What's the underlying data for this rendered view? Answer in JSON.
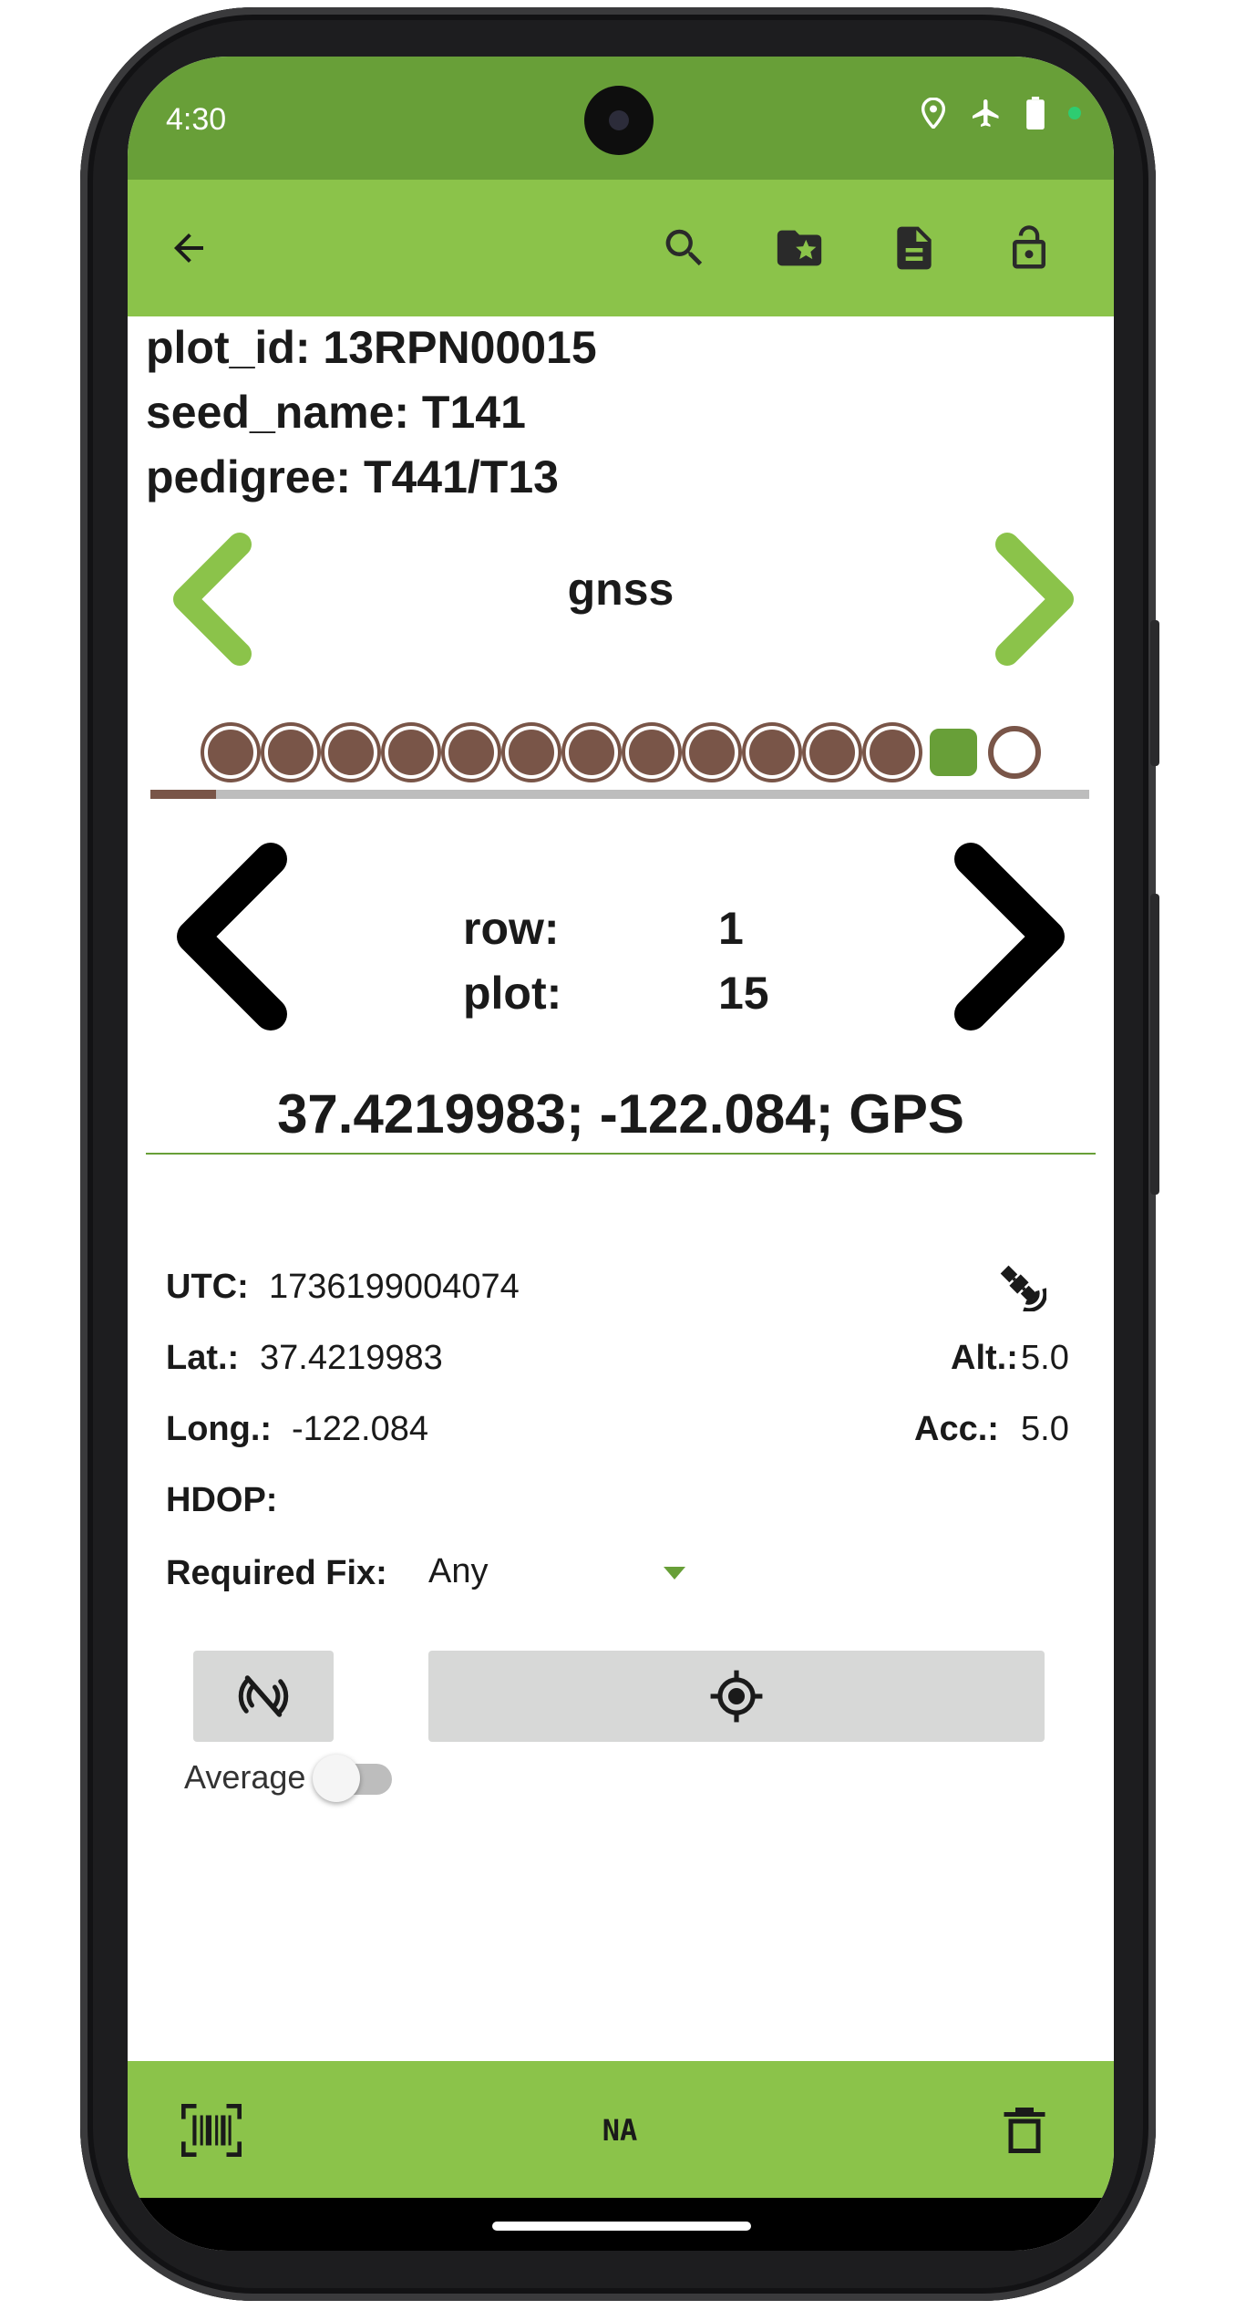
{
  "status_bar": {
    "time": "4:30",
    "icons": [
      "location-icon",
      "airplane-mode-icon",
      "battery-icon",
      "dot-indicator-icon"
    ],
    "indicator_color": "#2ecc71"
  },
  "toolbar": {
    "icons": [
      "back-arrow-icon",
      "search-icon",
      "folder-star-icon",
      "summary-document-icon",
      "lock-open-icon"
    ],
    "background": "#8bc34a"
  },
  "plot_info": {
    "plot_id": "plot_id: 13RPN00015",
    "seed_name": "seed_name: T141",
    "pedigree": "pedigree: T441/T13"
  },
  "trait": {
    "name": "gnss",
    "total": 14,
    "current_index": 13,
    "progress_fraction": 0.07
  },
  "range": {
    "row_label": "row:",
    "row_value": "1",
    "plot_label": "plot:",
    "plot_value": "15"
  },
  "gnss": {
    "value": "37.4219983; -122.084; GPS",
    "utc_label": "UTC:",
    "utc_value": "1736199004074",
    "lat_label": "Lat.:",
    "lat_value": "37.4219983",
    "alt_label": "Alt.:",
    "alt_value": "5.0",
    "long_label": "Long.:",
    "long_value": "-122.084",
    "acc_label": "Acc.:",
    "acc_value": "5.0",
    "hdop_label": "HDOP:",
    "hdop_value": "",
    "fix_label": "Required Fix:",
    "fix_value": "Any",
    "average_label": "Average",
    "average_on": false
  },
  "bottom_bar": {
    "barcode_icon": "barcode-scan-icon",
    "na_label": "NA",
    "delete_icon": "trash-icon"
  },
  "colors": {
    "status_green": "#689f38",
    "accent_green": "#8bc34a",
    "brown": "#795548",
    "button_gray": "#d7d8d7"
  }
}
